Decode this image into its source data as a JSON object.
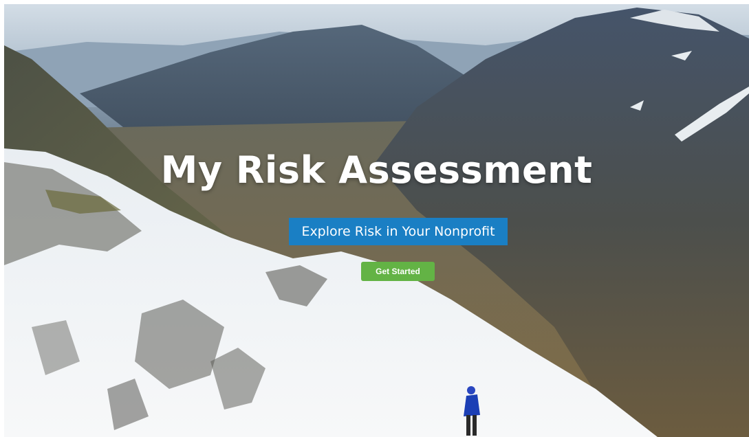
{
  "hero": {
    "title": "My Risk Assessment",
    "subtitle": "Explore Risk in Your Nonprofit",
    "cta_label": "Get Started"
  },
  "colors": {
    "subtitle_background": "#1a7fc4",
    "cta_background": "#63b345",
    "text": "#ffffff"
  }
}
